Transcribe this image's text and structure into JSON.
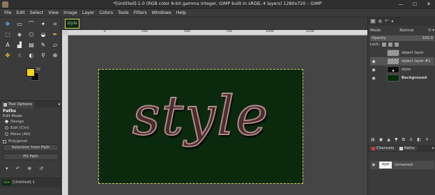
{
  "window": {
    "title": "*[Untitled]-1.0 (RGB color 8-bit gamma integer, GIMP built-in sRGB, 4 layers) 1280x720 – GIMP",
    "minimize": "—",
    "maximize": "☐",
    "close": "✕"
  },
  "menu": [
    "File",
    "Edit",
    "Select",
    "View",
    "Image",
    "Layer",
    "Colors",
    "Tools",
    "Filters",
    "Windows",
    "Help"
  ],
  "toolbox": {
    "tool_options_tab": "Tool Options",
    "options": {
      "title": "Paths",
      "edit_mode_label": "Edit Mode",
      "modes": [
        "Design",
        "Edit (Ctrl)",
        "Move (Alt)"
      ],
      "polygonal": "Polygonal",
      "selection_button": "Selection from Path",
      "fill_button": "Fill Path"
    },
    "image_tab_label": "[Untitled]-1",
    "image_thumb_text": "style"
  },
  "canvas": {
    "image_thumb_text": "style",
    "ruler_ticks": [
      "0",
      "250",
      "500",
      "750",
      "1000",
      "1250"
    ],
    "text": "style"
  },
  "dock": {
    "mode_label": "Mode",
    "mode_value": "Normal",
    "opacity_label": "Opacity",
    "opacity_value": "100.0",
    "lock_label": "Lock:",
    "layers": [
      {
        "name": "object layer",
        "visible": false,
        "bold": false
      },
      {
        "name": "object layer #1",
        "visible": true,
        "bold": false
      },
      {
        "name": "style",
        "visible": true,
        "bold": false
      },
      {
        "name": "Background",
        "visible": true,
        "bold": true
      }
    ],
    "tabs": {
      "channels": "Channels",
      "paths": "Paths"
    },
    "path_item": {
      "name": "Unnamed",
      "thumb_text": "style"
    }
  }
}
